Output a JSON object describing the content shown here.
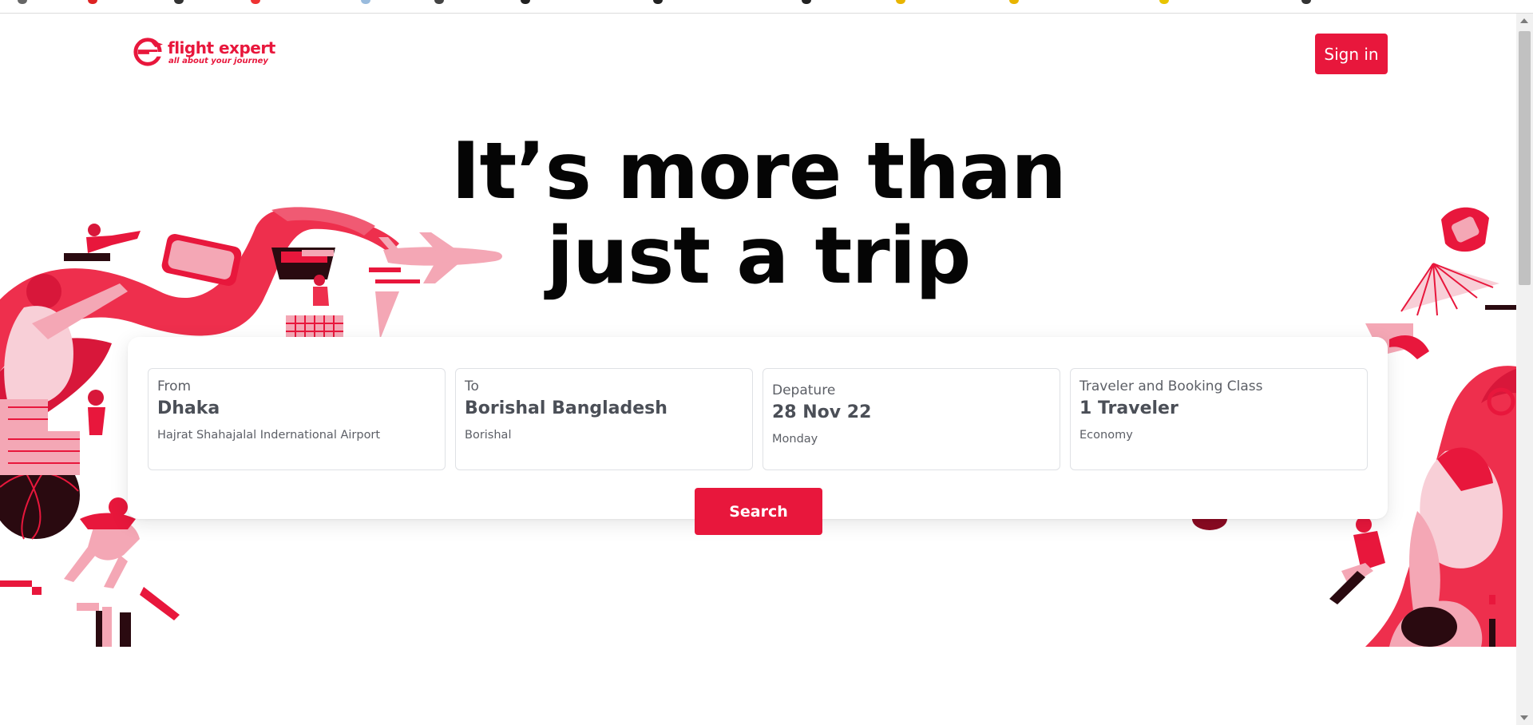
{
  "brand": {
    "name": "flight expert",
    "tagline": "all about your journey",
    "accent_color": "#e8173c"
  },
  "header": {
    "signin_label": "Sign in"
  },
  "hero": {
    "line1": "It’s more than",
    "line2": "just a trip"
  },
  "search": {
    "from": {
      "label": "From",
      "value": "Dhaka",
      "sub": "Hajrat Shahajalal Indernational Airport"
    },
    "to": {
      "label": "To",
      "value": "Borishal Bangladesh",
      "sub": "Borishal"
    },
    "departure": {
      "label": "Depature",
      "value": "28 Nov 22",
      "sub": "Monday"
    },
    "travelers": {
      "label": "Traveler and Booking Class",
      "value": "1 Traveler",
      "sub": "Economy"
    },
    "button_label": "Search"
  },
  "icons": {
    "logo": "flight-expert-logo-icon",
    "scroll_up": "chevron-up-icon",
    "scroll_down": "chevron-down-icon"
  }
}
